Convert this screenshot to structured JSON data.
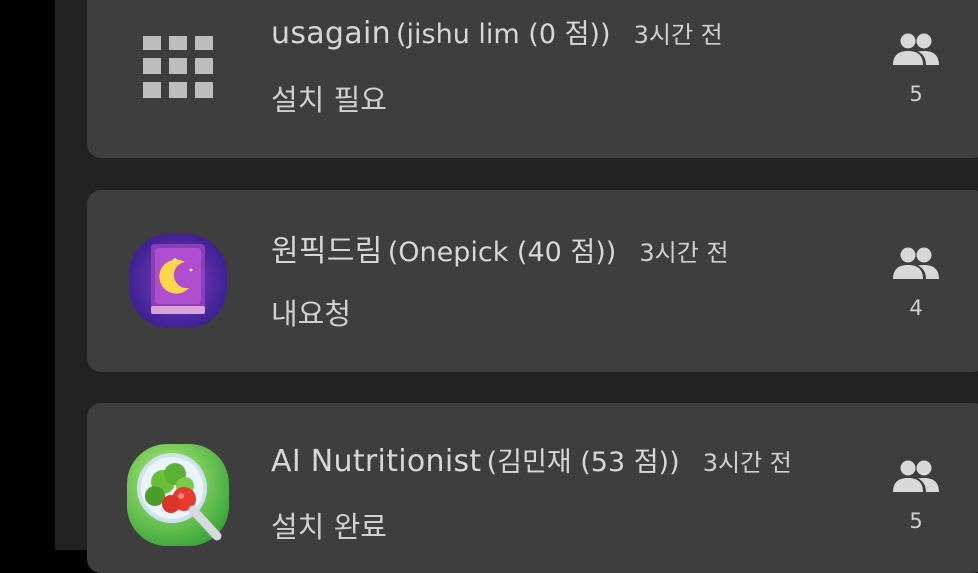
{
  "apps": [
    {
      "name": "usagain",
      "developer": "(jishu lim (0 점))",
      "time": "3시간 전",
      "status": "설치 필요",
      "participants": "5",
      "icon": "grid-icon"
    },
    {
      "name": "원픽드림",
      "developer": "(Onepick (40 점))",
      "time": "3시간 전",
      "status": "내요청",
      "participants": "4",
      "icon": "moon-book-icon"
    },
    {
      "name": "AI Nutritionist",
      "developer": "(김민재 (53 점))",
      "time": "3시간 전",
      "status": "설치 완료",
      "participants": "5",
      "icon": "vegetable-magnifier-icon"
    }
  ],
  "colors": {
    "background": "#000000",
    "panel": "#222222",
    "card": "#3e3e3e",
    "text": "#d7d7d7"
  }
}
